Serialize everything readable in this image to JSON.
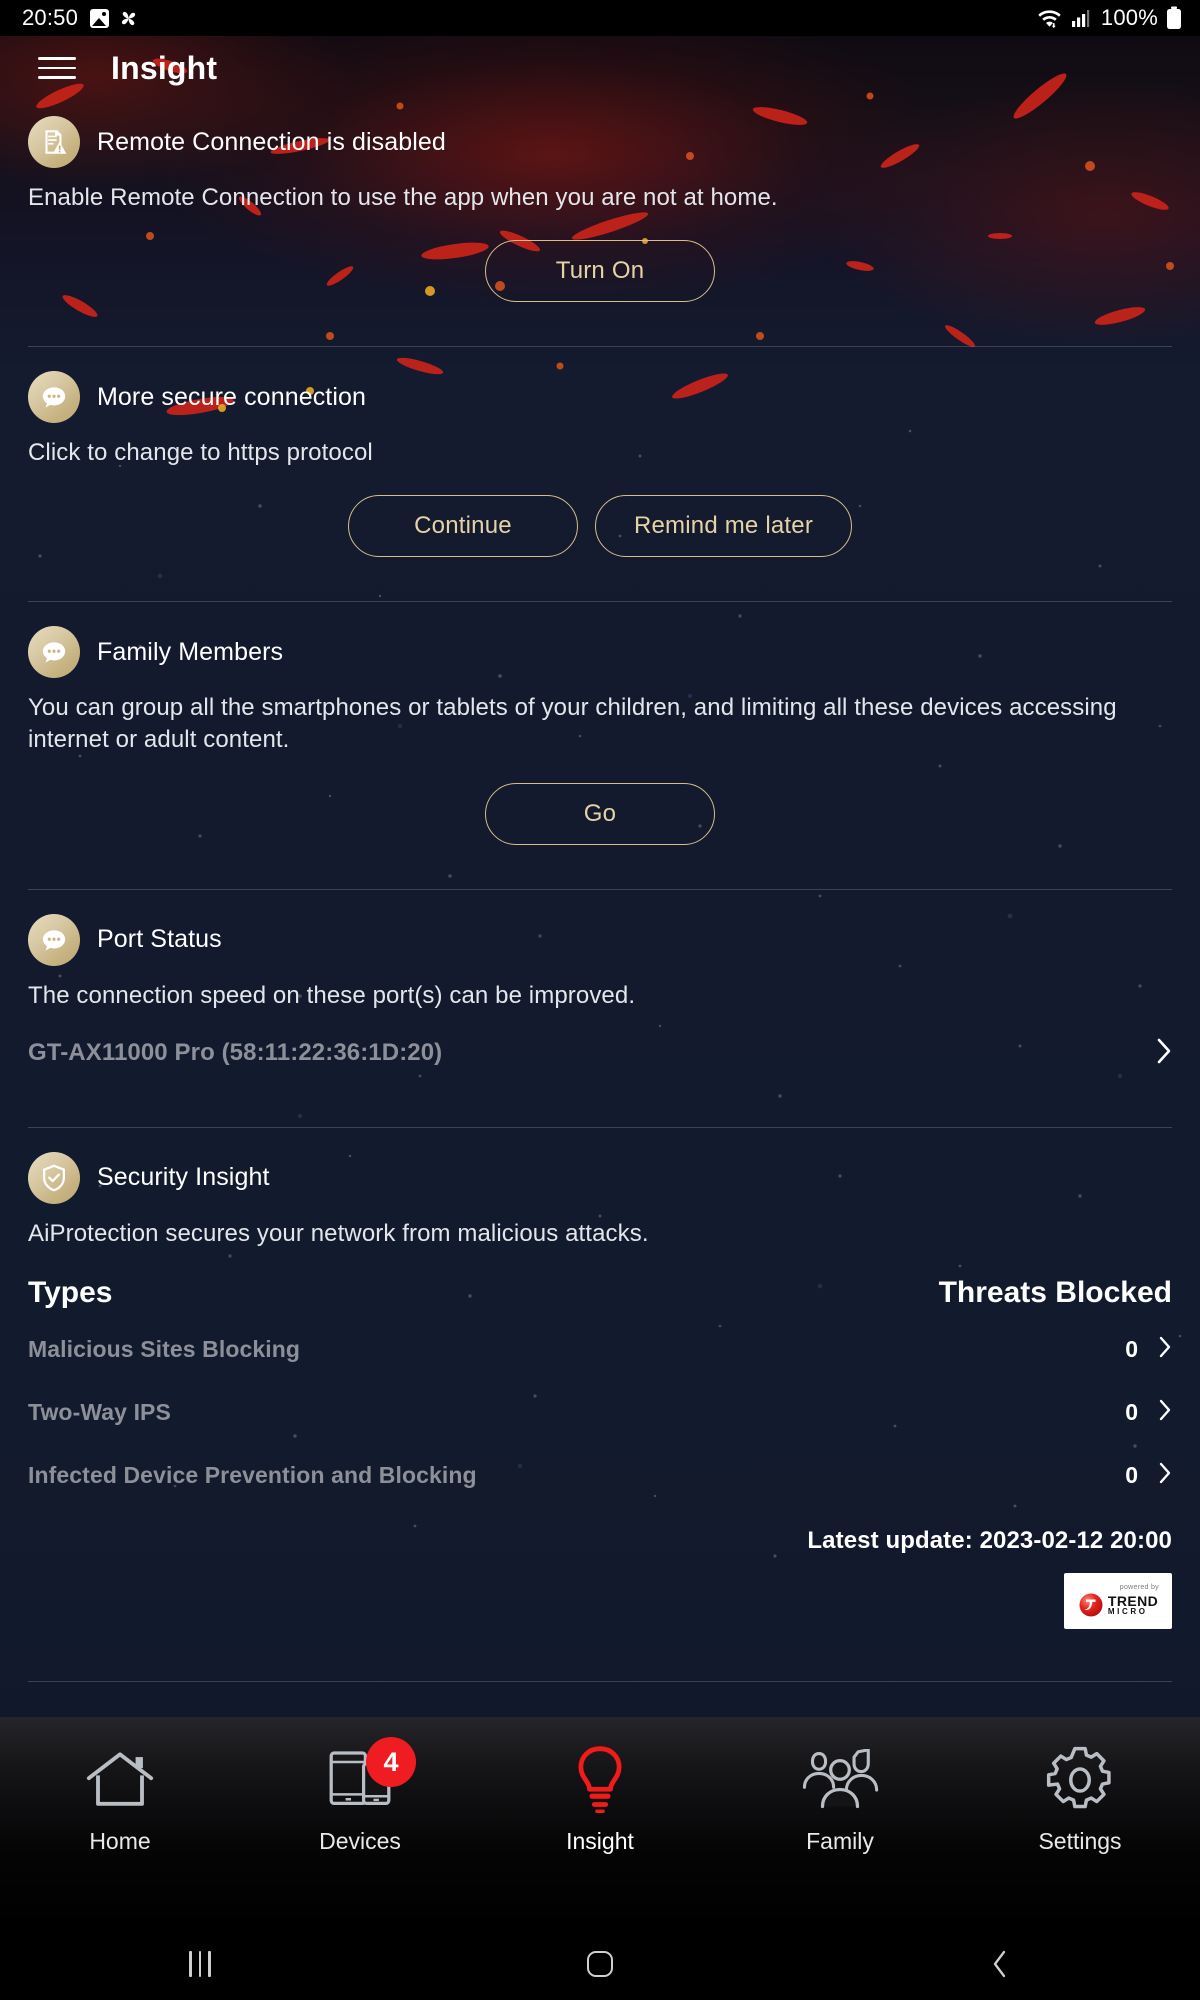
{
  "statusbar": {
    "time": "20:50",
    "battery_text": "100%",
    "icons": [
      "gallery-icon",
      "pinwheel-icon",
      "wifi-icon",
      "signal-icon",
      "battery-icon"
    ]
  },
  "appbar": {
    "menu_icon": "hamburger-menu-icon",
    "title": "Insight"
  },
  "cards": [
    {
      "icon": "document-warning-icon",
      "title": "Remote Connection is disabled",
      "desc": "Enable Remote Connection to use the app when you are not at home.",
      "buttons": [
        "Turn On"
      ]
    },
    {
      "icon": "chat-bubble-icon",
      "title": "More secure connection",
      "desc": "Click to change to https protocol",
      "buttons": [
        "Continue",
        "Remind me later"
      ]
    },
    {
      "icon": "chat-bubble-icon",
      "title": "Family Members",
      "desc": "You can group all the smartphones or tablets of your children, and limiting all these devices accessing internet or adult content.",
      "buttons": [
        "Go"
      ]
    },
    {
      "icon": "chat-bubble-icon",
      "title": "Port Status",
      "desc": "The connection speed on these port(s) can be improved.",
      "router": "GT-AX11000 Pro (58:11:22:36:1D:20)"
    }
  ],
  "security": {
    "icon": "shield-check-icon",
    "title": "Security Insight",
    "desc": "AiProtection secures your network from malicious attacks.",
    "table": {
      "col_types": "Types",
      "col_threats": "Threats Blocked",
      "rows": [
        {
          "name": "Malicious Sites Blocking",
          "value": "0"
        },
        {
          "name": "Two-Way IPS",
          "value": "0"
        },
        {
          "name": "Infected Device Prevention and Blocking",
          "value": "0"
        }
      ]
    },
    "latest_update": "Latest update: 2023-02-12 20:00",
    "logo": {
      "powered_by": "powered by",
      "brand_top": "TREND",
      "brand_bottom": "MICRO"
    }
  },
  "tabbar": {
    "items": [
      {
        "label": "Home",
        "icon": "home-icon",
        "active": false,
        "badge": null
      },
      {
        "label": "Devices",
        "icon": "devices-icon",
        "active": false,
        "badge": "4"
      },
      {
        "label": "Insight",
        "icon": "bulb-icon",
        "active": true,
        "badge": null
      },
      {
        "label": "Family",
        "icon": "family-icon",
        "active": false,
        "badge": null
      },
      {
        "label": "Settings",
        "icon": "gear-icon",
        "active": false,
        "badge": null
      }
    ]
  },
  "navbar": {
    "recents": "recents-icon",
    "home": "home-circle-icon",
    "back": "back-chevron-icon"
  },
  "colors": {
    "accent_gold": "#d6bd8b",
    "badge_red": "#ef1d22",
    "active_red": "#f21b1b",
    "bg_navy": "#131a2e",
    "muted_text": "#8d9099"
  }
}
